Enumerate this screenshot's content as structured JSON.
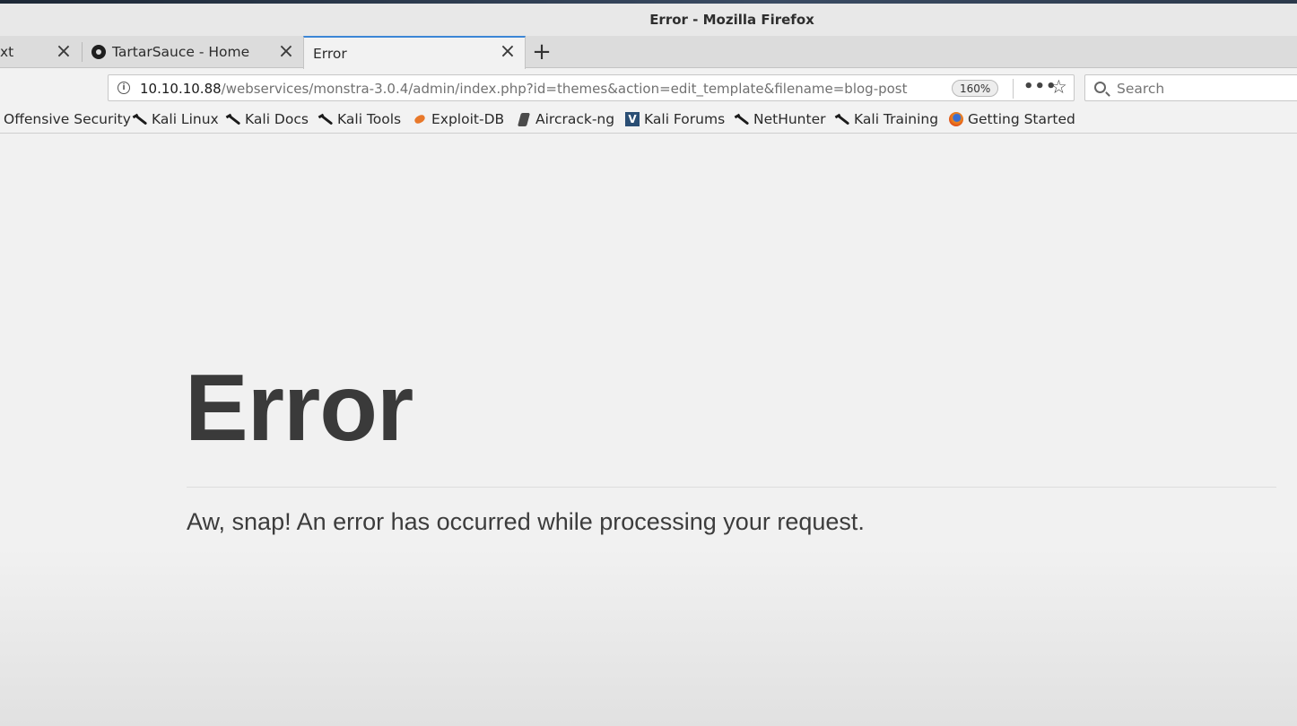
{
  "window": {
    "title": "Error - Mozilla Firefox"
  },
  "tabs": [
    {
      "label": "xt",
      "active": false
    },
    {
      "label": "TartarSauce - Home",
      "active": false,
      "icon": "tartarsauce-favicon"
    },
    {
      "label": "Error",
      "active": true
    }
  ],
  "toolbar": {
    "url_host": "10.10.10.88",
    "url_path": "/webservices/monstra-3.0.4/admin/index.php?id=themes&action=edit_template&filename=blog-post",
    "zoom": "160%",
    "search_placeholder": "Search"
  },
  "bookmarks": [
    {
      "label": "Offensive Security",
      "icon": "none"
    },
    {
      "label": "Kali Linux",
      "icon": "kali-dragon-icon"
    },
    {
      "label": "Kali Docs",
      "icon": "kali-dragon-icon"
    },
    {
      "label": "Kali Tools",
      "icon": "kali-dragon-icon"
    },
    {
      "label": "Exploit-DB",
      "icon": "exploit-db-icon"
    },
    {
      "label": "Aircrack-ng",
      "icon": "aircrack-icon"
    },
    {
      "label": "Kali Forums",
      "icon": "kali-forums-icon"
    },
    {
      "label": "NetHunter",
      "icon": "kali-dragon-icon"
    },
    {
      "label": "Kali Training",
      "icon": "kali-dragon-icon"
    },
    {
      "label": "Getting Started",
      "icon": "firefox-icon"
    }
  ],
  "page": {
    "heading": "Error",
    "message": "Aw, snap! An error has occurred while processing your request."
  },
  "colors": {
    "active_tab_accent": "#3c86d6",
    "page_background": "#f1f1f1",
    "heading_text": "#3a3a3a"
  }
}
